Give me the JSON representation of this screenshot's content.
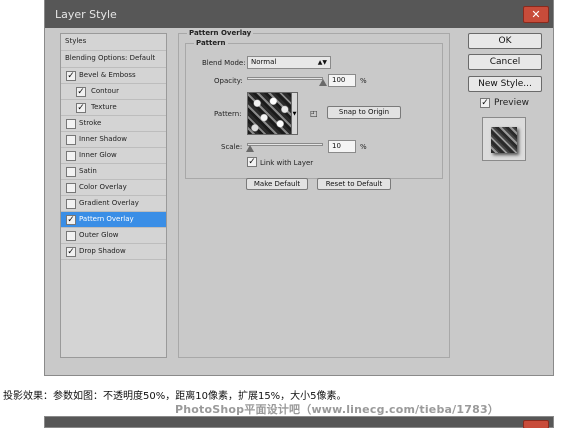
{
  "dialog": {
    "title": "Layer Style",
    "close_glyph": "✕"
  },
  "styles_list": {
    "header": "Styles",
    "blending": "Blending Options: Default",
    "items": [
      {
        "label": "Bevel & Emboss",
        "checked": true
      },
      {
        "label": "Contour",
        "checked": true
      },
      {
        "label": "Texture",
        "checked": true
      },
      {
        "label": "Stroke",
        "checked": false
      },
      {
        "label": "Inner Shadow",
        "checked": false
      },
      {
        "label": "Inner Glow",
        "checked": false
      },
      {
        "label": "Satin",
        "checked": false
      },
      {
        "label": "Color Overlay",
        "checked": false
      },
      {
        "label": "Gradient Overlay",
        "checked": false
      },
      {
        "label": "Pattern Overlay",
        "checked": true
      },
      {
        "label": "Outer Glow",
        "checked": false
      },
      {
        "label": "Drop Shadow",
        "checked": true
      }
    ]
  },
  "pattern_overlay": {
    "section_title": "Pattern Overlay",
    "group_title": "Pattern",
    "blend_mode_label": "Blend Mode:",
    "blend_mode_value": "Normal",
    "opacity_label": "Opacity:",
    "opacity_value": "100",
    "percent": "%",
    "pattern_label": "Pattern:",
    "snap_to_origin": "Snap to Origin",
    "scale_label": "Scale:",
    "scale_value": "10",
    "link_with_layer": "Link with Layer",
    "link_checked": true,
    "make_default": "Make Default",
    "reset_to_default": "Reset to Default"
  },
  "buttons": {
    "ok": "OK",
    "cancel": "Cancel",
    "new_style": "New Style...",
    "preview": "Preview"
  },
  "caption": "投影效果：参数如图：不透明度50%，距离10像素，扩展15%，大小5像素。",
  "watermark": "PhotoShop平面设计吧（www.linecg.com/tieba/1783）",
  "check_glyph": "✓"
}
